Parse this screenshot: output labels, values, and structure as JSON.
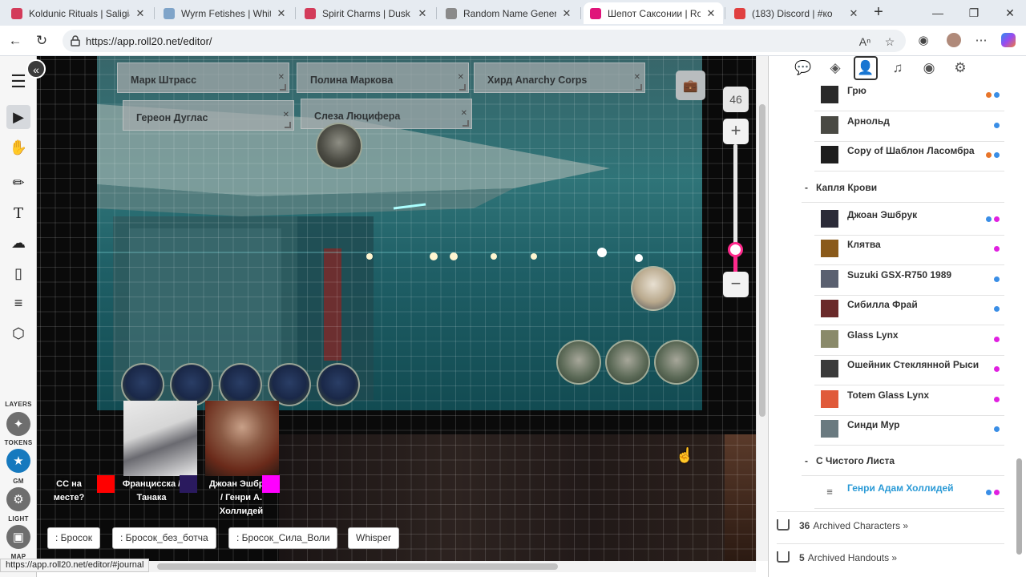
{
  "browser": {
    "tabs": [
      {
        "title": "Koldunic Rituals | Saligia",
        "icon_color": "#d33b5a",
        "active": false
      },
      {
        "title": "Wyrm Fetishes | White W",
        "icon_color": "#7fa4c9",
        "active": false
      },
      {
        "title": "Spirit Charms | Dusk Wi",
        "icon_color": "#d33b5a",
        "active": false
      },
      {
        "title": "Random Name Generato",
        "icon_color": "#8a8a8a",
        "active": false
      },
      {
        "title": "Шепот Саксонии | Roll2",
        "icon_color": "#e0147a",
        "active": true
      },
      {
        "title": "(183) Discord | #ко",
        "icon_color": "#e04040",
        "active": false
      }
    ],
    "discord_badge": "183",
    "close_symbol": "✕",
    "new_tab_symbol": "+",
    "url": "https://app.roll20.net/editor/",
    "status_url": "https://app.roll20.net/editor/#journal"
  },
  "canvas": {
    "zoom_value": "46",
    "zoom_level": 0.23,
    "name_boxes": [
      {
        "label": "Марк Штрасс"
      },
      {
        "label": "Полина Маркова"
      },
      {
        "label": "Хирд Anarchy Corps"
      },
      {
        "label": "Гереон Дуглас"
      },
      {
        "label": "Слеза Люцифера"
      }
    ],
    "players": [
      {
        "label": "СС на месте?",
        "color": "#ff0000"
      },
      {
        "label": "Франциcска / Танака",
        "color": "#2a1a5e"
      },
      {
        "label": "Джоан Эшбрук / Генри А. Холлидей",
        "color": "#ff00ff"
      }
    ],
    "macros": [
      ": Бросок",
      ": Бросок_без_ботча",
      ": Бросок_Сила_Воли",
      "Whisper"
    ]
  },
  "sidebar": {
    "tab_icons": [
      "chat-icon",
      "compendium-icon",
      "journal-icon",
      "jukebox-icon",
      "collections-icon",
      "settings-icon"
    ],
    "active_tab": "journal-icon",
    "items": [
      {
        "name": "Грю",
        "avatar_color": "#2a2a2a",
        "dots": [
          "#e8752a",
          "#3a8ee6"
        ]
      },
      {
        "name": "Арнольд",
        "avatar_color": "#4a4a44",
        "dots": [
          "#3a8ee6"
        ]
      },
      {
        "name": "Copy of Шаблон Ласомбра",
        "avatar_color": "#1e1e1e",
        "dots": [
          "#e8752a",
          "#3a8ee6"
        ]
      }
    ],
    "folders": [
      {
        "name": "Капля Крови",
        "items": [
          {
            "name": "Джоан Эшбрук",
            "avatar_color": "#2b2b38",
            "dots": [
              "#3a8ee6",
              "#e020e0"
            ]
          },
          {
            "name": "Клятва",
            "avatar_color": "#8a5a1a",
            "dots": [
              "#e020e0"
            ]
          },
          {
            "name": "Suzuki GSX-R750 1989",
            "avatar_color": "#5a6070",
            "dots": [
              "#3a8ee6"
            ]
          },
          {
            "name": "Сибилла Фрай",
            "avatar_color": "#6a2a2a",
            "dots": [
              "#3a8ee6"
            ]
          },
          {
            "name": "Glass Lynx",
            "avatar_color": "#8a8a6a",
            "dots": [
              "#e020e0"
            ]
          },
          {
            "name": "Ошейник Стеклянной Рыси",
            "avatar_color": "#3a3a3a",
            "dots": [
              "#e020e0"
            ]
          },
          {
            "name": "Totem Glass Lynx",
            "avatar_color": "#e05a3a",
            "dots": [
              "#e020e0"
            ]
          },
          {
            "name": "Синди Мур",
            "avatar_color": "#6a7a80",
            "dots": [
              "#3a8ee6"
            ]
          }
        ]
      },
      {
        "name": "С Чистого Листа",
        "items": [
          {
            "name": "Генри Адам Холлидей",
            "avatar_color": "",
            "dots": [
              "#3a8ee6",
              "#e020e0"
            ],
            "highlight": true
          }
        ]
      }
    ],
    "archived": [
      {
        "count": "36",
        "label": "Archived Characters »"
      },
      {
        "count": "5",
        "label": "Archived Handouts »"
      }
    ]
  },
  "layers": {
    "labels": [
      "LAYERS",
      "TOKENS",
      "GM",
      "LIGHT",
      "MAP"
    ]
  }
}
